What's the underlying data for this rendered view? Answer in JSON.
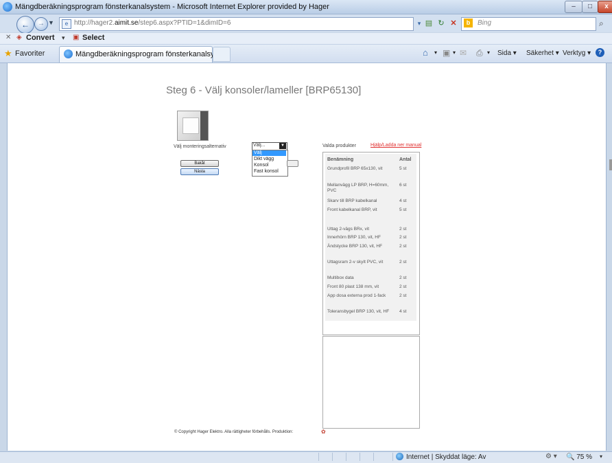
{
  "window": {
    "title": "Mängdberäkningsprogram fönsterkanalsystem - Microsoft Internet Explorer provided by Hager",
    "min_label": "–",
    "max_label": "□",
    "close_label": "x"
  },
  "address_bar": {
    "url_prefix": "http://hager2.",
    "url_domain": "aimit.se",
    "url_suffix": "/step6.aspx?PTID=1&dimID=6",
    "search_placeholder": "Bing"
  },
  "toolbar": {
    "convert_label": "Convert",
    "select_label": "Select"
  },
  "favorites": {
    "label": "Favoriter",
    "tab_title": "Mängdberäkningsprogram fönsterkanalsystem",
    "page_menu": "Sida ▾",
    "safety_menu": "Säkerhet ▾",
    "tools_menu": "Verktyg ▾"
  },
  "page": {
    "title": "Steg 6 - Välj konsoler/lameller [BRP65130]",
    "mount_label": "Välj monteringsalternativ",
    "mount_select_value": "Välj...",
    "dropdown_options": [
      "Välj",
      "Dikt vägg",
      "Konsol",
      "Fast konsol"
    ],
    "back_button": "Bakåt",
    "next_button": "Nästa",
    "selected_label": "Valda produkter",
    "manual_link": "Hjälp/Ladda ner manual",
    "list_headers": {
      "name": "Benämning",
      "qty": "Antal"
    },
    "products": [
      {
        "name": "Grundprofil BRP 65x130, vit",
        "qty": "5 st"
      },
      {
        "name": "Mellanvägg LP BRP, H=60mm, PVC",
        "qty": "6 st"
      },
      {
        "name": "Skarv till BRP kabelkanal",
        "qty": "4 st"
      },
      {
        "name": "Front kabelkanal BRP, vit",
        "qty": "5 st"
      },
      {
        "name": "Uttag 2-vägs BRx, vit",
        "qty": "2 st"
      },
      {
        "name": "Innerhörn BRP 130, vit, HF",
        "qty": "2 st"
      },
      {
        "name": "Ändstycke BRP 130, vit, HF",
        "qty": "2 st"
      },
      {
        "name": "Uttagsram 2-v skyIt PVC, vit",
        "qty": "2 st"
      },
      {
        "name": "Multibox data",
        "qty": "2 st"
      },
      {
        "name": "Front 80 plast 138 mm, vit",
        "qty": "2 st"
      },
      {
        "name": "App dosa externa prod 1-fack",
        "qty": "2 st"
      },
      {
        "name": "Toleransbygel BRP 130, vit, HF",
        "qty": "4 st"
      }
    ],
    "copyright": "© Copyright Hager Elektro. Alla rättigheter förbehålls. Produktion:"
  },
  "status": {
    "zone": "Internet | Skyddat läge: Av",
    "zoom": "75 %"
  },
  "icons": {
    "back": "back-arrow-icon",
    "refresh": "refresh-icon",
    "stop": "stop-icon",
    "home": "home-icon",
    "print": "print-icon",
    "help": "help-icon",
    "favorites": "star-icon"
  },
  "colors": {
    "link_red": "#e03030",
    "selected_option": "#3399ff",
    "title_gray": "#777777"
  }
}
